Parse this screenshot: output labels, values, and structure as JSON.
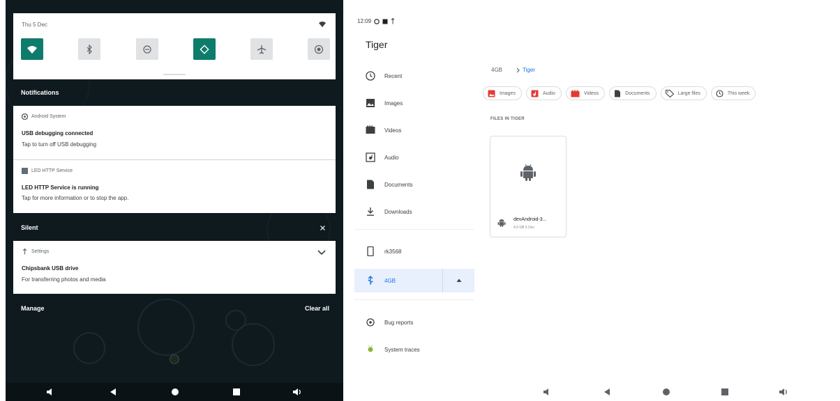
{
  "shade": {
    "date": "Thu 5 Dec",
    "tiles": [
      {
        "icon": "wifi-icon",
        "on": true
      },
      {
        "icon": "bluetooth-icon",
        "on": false
      },
      {
        "icon": "do-not-disturb-icon",
        "on": false
      },
      {
        "icon": "auto-rotate-icon",
        "on": true
      },
      {
        "icon": "airplane-mode-icon",
        "on": false
      },
      {
        "icon": "screen-record-icon",
        "on": false
      }
    ],
    "notifications_header": "Notifications",
    "notifications": [
      {
        "app": "Android System",
        "title": "USB debugging connected",
        "text": "Tap to turn off USB debugging"
      },
      {
        "app": "LED HTTP Service",
        "title": "LED HTTP Service is running",
        "text": "Tap for more information or to stop the app."
      }
    ],
    "silent_header": "Silent",
    "silent_notifications": [
      {
        "app": "Settings",
        "title": "Chipsbank USB drive",
        "text": "For transferring photos and media"
      }
    ],
    "manage_label": "Manage",
    "clear_all_label": "Clear all",
    "accent": "#0e7c6b"
  },
  "files_app": {
    "status_time": "12:09",
    "title": "Tiger",
    "sidebar": {
      "items": [
        {
          "label": "Recent",
          "icon": "clock-icon"
        },
        {
          "label": "Images",
          "icon": "image-icon"
        },
        {
          "label": "Videos",
          "icon": "video-icon"
        },
        {
          "label": "Audio",
          "icon": "audio-icon"
        },
        {
          "label": "Documents",
          "icon": "document-icon"
        },
        {
          "label": "Downloads",
          "icon": "download-icon"
        }
      ],
      "devices": [
        {
          "label": "rk3568",
          "icon": "phone-icon"
        },
        {
          "label": "4GB",
          "icon": "usb-icon",
          "active": true
        }
      ],
      "extras": [
        {
          "label": "Bug reports",
          "icon": "bug-report-icon"
        },
        {
          "label": "System traces",
          "icon": "system-traces-icon"
        }
      ]
    },
    "breadcrumb": {
      "root": "4GB",
      "current": "Tiger"
    },
    "chips": [
      {
        "label": "Images",
        "icon": "image-icon"
      },
      {
        "label": "Audio",
        "icon": "audio-icon"
      },
      {
        "label": "Videos",
        "icon": "video-icon"
      },
      {
        "label": "Documents",
        "icon": "document-icon"
      },
      {
        "label": "Large files",
        "icon": "tag-icon"
      },
      {
        "label": "This week",
        "icon": "history-icon"
      }
    ],
    "section_label": "FILES IN TIGER",
    "file": {
      "name": "devAndroid-3...",
      "meta": "4.0 GB 5 Dec",
      "icon": "android-icon"
    },
    "accent": "#1a73e8"
  },
  "nav_bar": [
    "volume-down-icon",
    "back-icon",
    "home-icon",
    "recents-icon",
    "volume-up-icon"
  ]
}
